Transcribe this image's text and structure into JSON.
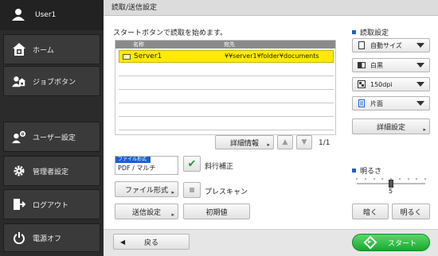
{
  "sidebar": {
    "user_label": "User1",
    "items": [
      {
        "label": "ホーム",
        "icon": "home-icon"
      },
      {
        "label": "ジョブボタン",
        "icon": "job-button-icon"
      },
      {
        "label": "ユーザー設定",
        "icon": "user-settings-icon"
      },
      {
        "label": "管理者設定",
        "icon": "gear-icon"
      },
      {
        "label": "ログアウト",
        "icon": "logout-icon"
      },
      {
        "label": "電源オフ",
        "icon": "power-icon"
      }
    ]
  },
  "main": {
    "title": "読取/送信設定",
    "instruction": "スタートボタンで読取を始めます。",
    "table": {
      "headers": [
        "名称",
        "宛先"
      ],
      "rows": [
        {
          "name": "Server1",
          "destination": "¥¥server1¥folder¥documents"
        }
      ]
    },
    "details_label": "詳細情報",
    "page_indicator": "1/1",
    "file_format": {
      "caption": "ファイル形式",
      "value": "PDF / マルチ"
    },
    "skew_label": "斜行補正",
    "file_format_btn": "ファイル形式",
    "prescan_label": "プレスキャン",
    "send_settings_btn": "送信設定",
    "reset_btn": "初期値",
    "back_label": "戻る",
    "start_label": "スタート"
  },
  "scan_settings": {
    "title": "読取設定",
    "size": "自動サイズ",
    "color": "白黒",
    "resolution": "150dpi",
    "sides": "片面",
    "detail_btn": "詳細設定"
  },
  "brightness": {
    "title": "明るさ",
    "value": "5",
    "level": 5,
    "max": 9,
    "darker_label": "暗く",
    "lighter_label": "明るく"
  },
  "colors": {
    "selection": "#ffea00",
    "accent": "#1a5fd0",
    "start": "#18a830"
  }
}
